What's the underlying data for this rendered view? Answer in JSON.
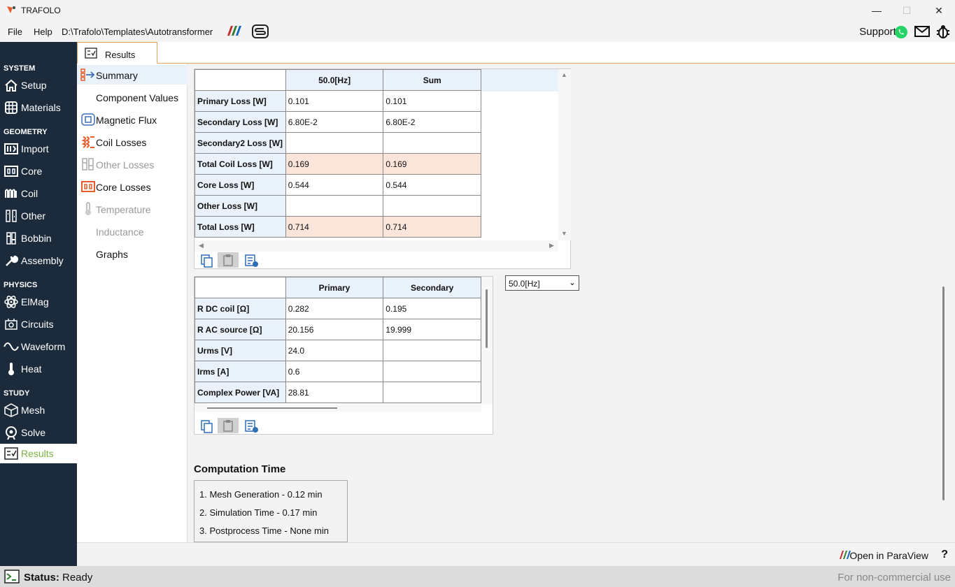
{
  "window": {
    "title": "TRAFOLO",
    "minimize": "—",
    "maximize": "☐",
    "close": "✕"
  },
  "menu": {
    "file": "File",
    "help": "Help",
    "path": "D:\\Trafolo\\Templates\\Autotransformer"
  },
  "support": {
    "label": "Support:"
  },
  "tab": {
    "label": "Results"
  },
  "nav": {
    "system": "SYSTEM",
    "geometry": "GEOMETRY",
    "physics": "PHYSICS",
    "study": "STUDY",
    "setup": "Setup",
    "materials": "Materials",
    "import": "Import",
    "core": "Core",
    "coil": "Coil",
    "other": "Other",
    "bobbin": "Bobbin",
    "assembly": "Assembly",
    "elmag": "ElMag",
    "circuits": "Circuits",
    "waveform": "Waveform",
    "heat": "Heat",
    "mesh": "Mesh",
    "solve": "Solve",
    "results": "Results"
  },
  "subnav": {
    "summary": "Summary",
    "component_values": "Component Values",
    "magnetic_flux": "Magnetic Flux",
    "coil_losses": "Coil Losses",
    "other_losses": "Other Losses",
    "core_losses": "Core Losses",
    "temperature": "Temperature",
    "inductance": "Inductance",
    "graphs": "Graphs"
  },
  "loss_table": {
    "headers": [
      "50.0[Hz]",
      "Sum"
    ],
    "rows": [
      {
        "label": "Primary Loss [W]",
        "v1": "0.101",
        "v2": "0.101"
      },
      {
        "label": "Secondary Loss [W]",
        "v1": "6.80E-2",
        "v2": "6.80E-2"
      },
      {
        "label": "Secondary2 Loss [W]",
        "v1": "",
        "v2": ""
      },
      {
        "label": "Total Coil Loss [W]",
        "v1": "0.169",
        "v2": "0.169"
      },
      {
        "label": "Core Loss [W]",
        "v1": "0.544",
        "v2": "0.544"
      },
      {
        "label": "Other Loss [W]",
        "v1": "",
        "v2": ""
      },
      {
        "label": "Total Loss [W]",
        "v1": "0.714",
        "v2": "0.714"
      }
    ]
  },
  "circuit_table": {
    "headers": [
      "Primary",
      "Secondary"
    ],
    "rows": [
      {
        "label": "R DC coil [Ω]",
        "v1": "0.282",
        "v2": "0.195"
      },
      {
        "label": "R AC source [Ω]",
        "v1": "20.156",
        "v2": "19.999"
      },
      {
        "label": "Urms [V]",
        "v1": "24.0",
        "v2": ""
      },
      {
        "label": "Irms [A]",
        "v1": "0.6",
        "v2": ""
      },
      {
        "label": "Complex Power [VA]",
        "v1": "28.81",
        "v2": ""
      }
    ]
  },
  "frequency_select": {
    "value": "50.0[Hz]"
  },
  "computation": {
    "title": "Computation Time",
    "lines": [
      "1. Mesh Generation -  0.12 min",
      "2. Simulation Time -  0.17 min",
      "3. Postprocess Time -  None min"
    ]
  },
  "footer": {
    "paraview": "Open in ParaView",
    "help": "?"
  },
  "status": {
    "text": "Status: Ready",
    "license": "For non-commercial use"
  },
  "colors": {
    "accent": "#e8a060",
    "nav_bg": "#1b2b3c",
    "active": "#7cb342",
    "highlight": "#fbe4da"
  }
}
